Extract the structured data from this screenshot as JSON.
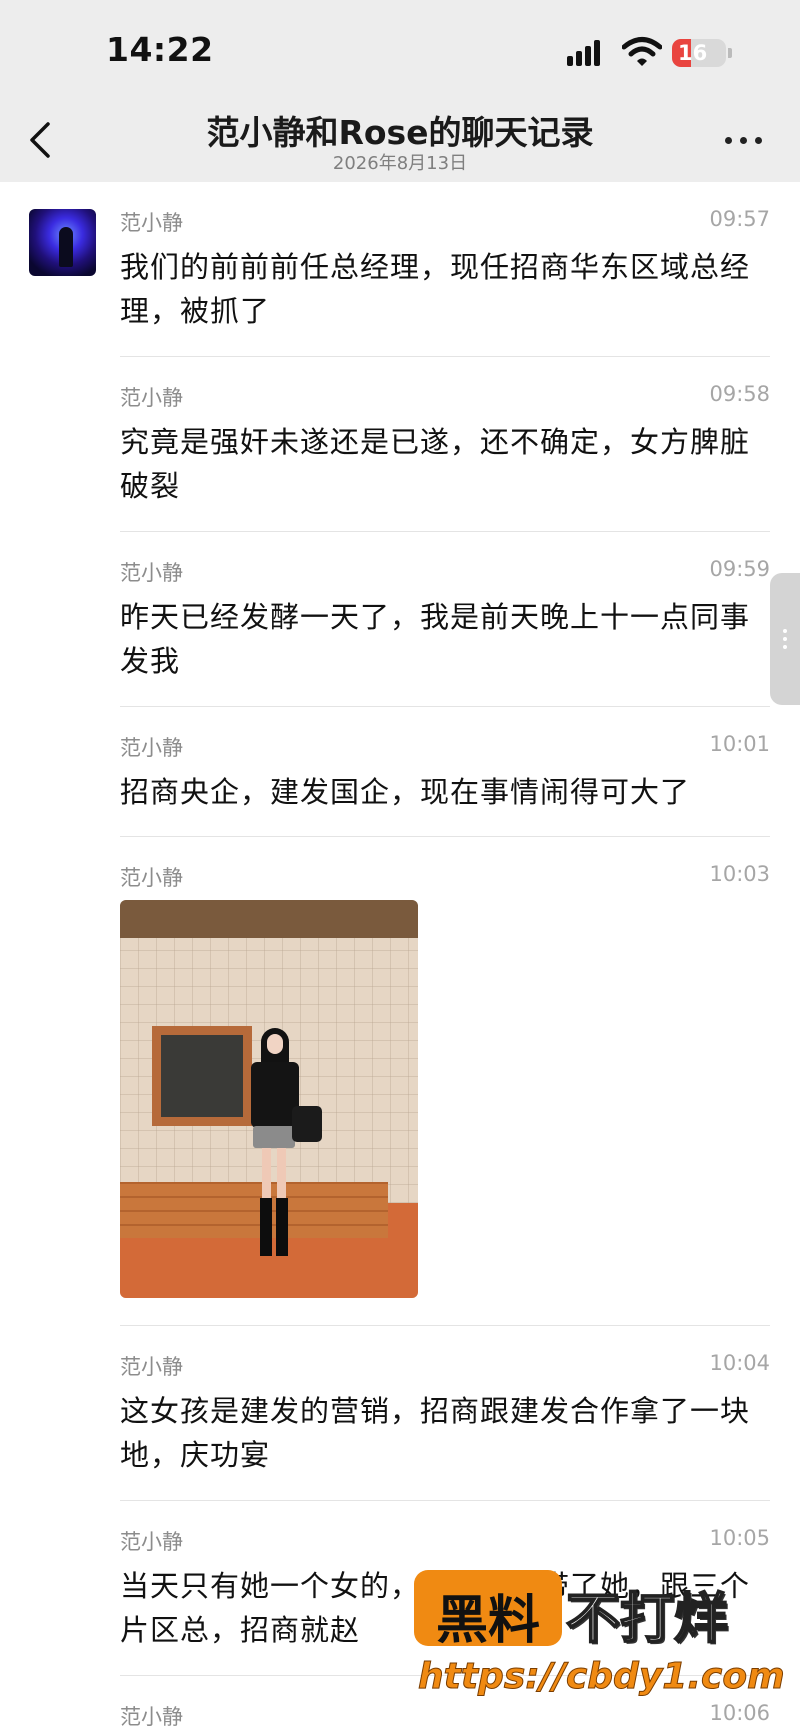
{
  "status_bar": {
    "time": "14:22",
    "battery_level": "16",
    "battery_fraction": 0.16
  },
  "nav": {
    "title": "范小静和Rose的聊天记录",
    "date": "2026年8月13日",
    "back_icon": "chevron-left-icon",
    "more_icon": "more-horizontal-icon"
  },
  "messages": [
    {
      "sender": "范小静",
      "time": "09:57",
      "text": "我们的前前前任总经理，现任招商华东区域总经理，被抓了"
    },
    {
      "sender": "范小静",
      "time": "09:58",
      "text": "究竟是强奸未遂还是已遂，还不确定，女方脾脏破裂"
    },
    {
      "sender": "范小静",
      "time": "09:59",
      "text": "昨天已经发酵一天了，我是前天晚上十一点同事发我"
    },
    {
      "sender": "范小静",
      "time": "10:01",
      "text": "招商央企，建发国企，现在事情闹得可大了"
    },
    {
      "sender": "范小静",
      "time": "10:03",
      "type": "image"
    },
    {
      "sender": "范小静",
      "time": "10:04",
      "text": "这女孩是建发的营销，招商跟建发合作拿了一块地，庆功宴"
    },
    {
      "sender": "范小静",
      "time": "10:05",
      "text": "当天只有她一个女的，建发领导带了她，跟三个片区总，招商就赵"
    },
    {
      "sender": "范小静",
      "time": "10:06"
    }
  ],
  "watermark": {
    "badge": "黑料",
    "brand": "不打烊",
    "url": "https://cbdy1.com",
    "color": "#f08a12"
  },
  "colors": {
    "header_bg": "#ededed",
    "battery_red": "#e9443f"
  }
}
